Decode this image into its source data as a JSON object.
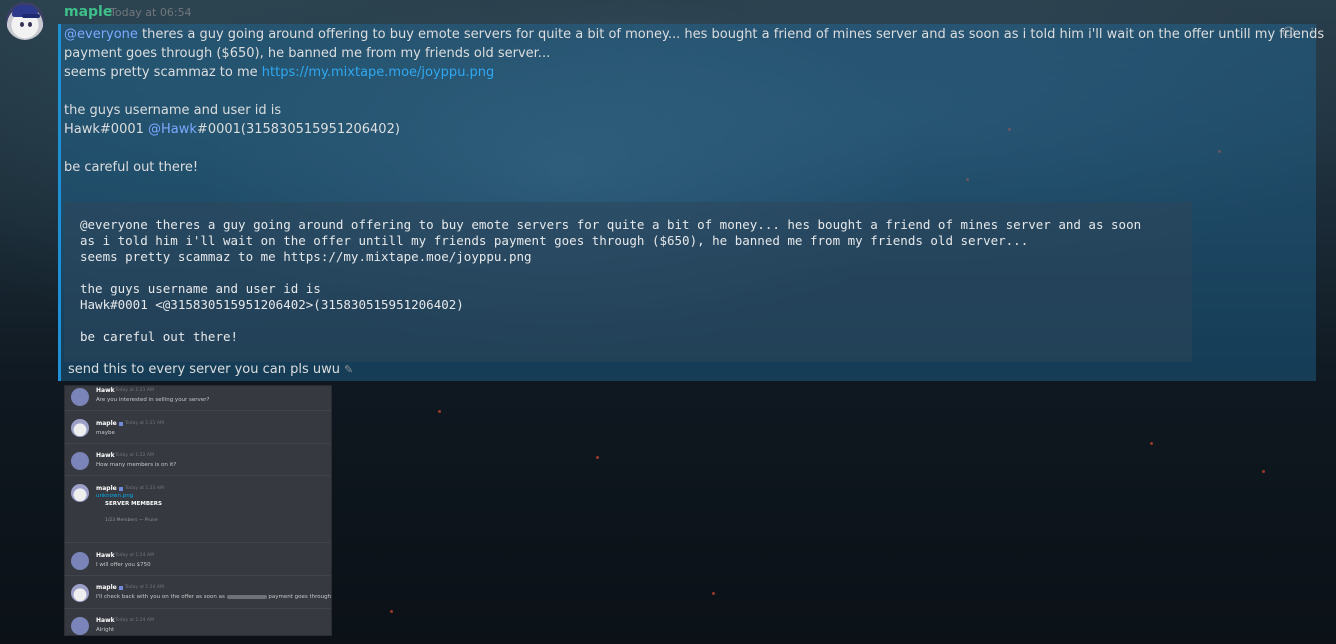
{
  "message": {
    "username": "maple",
    "timestamp": "Today at 06:54",
    "lines": {
      "l1_mention": "@everyone",
      "l1_text": " theres a guy going around offering to buy emote servers for quite a bit of money... hes bought a friend of mines server and as soon as i told him i'll wait on the offer untill my friends",
      "l2_text": "payment goes through ($650), he banned me from my friends old server...",
      "l3_text": "seems pretty scammaz to me ",
      "l3_link": "https://my.mixtape.moe/joyppu.png",
      "l5_text": "the guys username and user id is",
      "l6_text1": "Hawk#0001 ",
      "l6_mention": "@Hawk",
      "l6_text2": "#0001(315830515951206402)",
      "l8_text": "be careful out there!"
    },
    "codeblock": [
      "@everyone theres a guy going around offering to buy emote servers for quite a bit of money... hes bought a friend of mines server and as soon",
      "as i told him i'll wait on the offer untill my friends payment goes through ($650), he banned me from my friends old server...",
      "seems pretty scammaz to me https://my.mixtape.moe/joyppu.png",
      "",
      "the guys username and user id is",
      "Hawk#0001 <@315830515951206402>(315830515951206402)",
      "",
      "be careful out there!"
    ],
    "edit_text": "send this to every server you can pls uwu",
    "actions": {
      "emoji_icon": "☺",
      "more_icon": "⋮"
    }
  },
  "attachment": {
    "messages": [
      {
        "author": "Hawk",
        "time": "Today at 1:21 AM",
        "text": "Are you interested in selling your server?"
      },
      {
        "author": "maple",
        "time": "Today at 1:21 AM",
        "text": "maybe"
      },
      {
        "author": "Hawk",
        "time": "Today at 1:22 AM",
        "text": "How many members is on it?"
      },
      {
        "author": "maple",
        "time": "Today at 1:23 AM",
        "link": "unknown.png",
        "embed_title": "SERVER MEMBERS",
        "embed_sub": "1/23 Members — Prune"
      },
      {
        "author": "Hawk",
        "time": "Today at 1:24 AM",
        "text": "I will offer you $750"
      },
      {
        "author": "maple",
        "time": "Today at 1:24 AM",
        "text_a": "I'll check back with you on the offer as soon as",
        "text_b": "payment goes through"
      },
      {
        "author": "Hawk",
        "time": "Today at 1:24 AM",
        "text": "Alright"
      }
    ]
  }
}
